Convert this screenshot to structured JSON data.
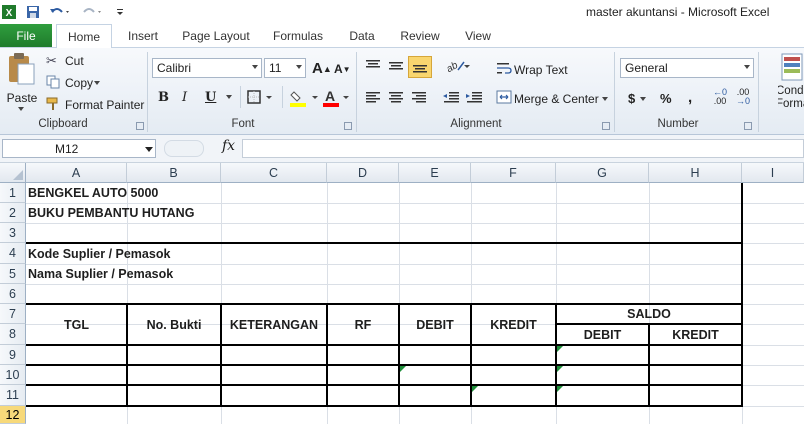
{
  "window": {
    "title": "master akuntansi  -  Microsoft Excel"
  },
  "qat": {
    "undo_icon": "undo-icon",
    "redo_icon": "redo-icon",
    "save_icon": "save-icon",
    "app_icon": "excel-logo"
  },
  "tabs": [
    "File",
    "Home",
    "Insert",
    "Page Layout",
    "Formulas",
    "Data",
    "Review",
    "View"
  ],
  "clipboard": {
    "paste": "Paste",
    "cut": "Cut",
    "copy": "Copy",
    "format_painter": "Format Painter",
    "label": "Clipboard"
  },
  "font": {
    "name": "Calibri",
    "size": "11",
    "label": "Font",
    "bold": "B",
    "italic": "I",
    "underline": "U",
    "grow": "A",
    "shrink": "A",
    "color_letter": "A",
    "fill_color": "#ffff00",
    "font_color": "#ff0000"
  },
  "alignment": {
    "wrap_text": "Wrap Text",
    "merge_center": "Merge & Center",
    "label": "Alignment"
  },
  "number": {
    "format": "General",
    "currency": "$",
    "percent": "%",
    "comma": ",",
    "inc_decimal": ".00",
    "dec_decimal": ".00",
    "label": "Number"
  },
  "styles": {
    "conditional_formatting": "Conditional Formatting"
  },
  "formula_bar": {
    "name_box": "M12",
    "fx": "fx",
    "value": ""
  },
  "columns": [
    "A",
    "B",
    "C",
    "D",
    "E",
    "F",
    "G",
    "H",
    "I"
  ],
  "rows": [
    "1",
    "2",
    "3",
    "4",
    "5",
    "6",
    "7",
    "8",
    "9",
    "10",
    "11",
    "12"
  ],
  "cells": {
    "A1": "BENGKEL AUTO 5000",
    "A2": "BUKU PEMBANTU HUTANG",
    "A4": "Kode Suplier / Pemasok",
    "A5": "Nama Suplier / Pemasok",
    "A7": "TGL",
    "B7": "No. Bukti",
    "C7": "KETERANGAN",
    "D7": "RF",
    "E7": "DEBIT",
    "F7": "KREDIT",
    "G7": "SALDO",
    "G8": "DEBIT",
    "H8": "KREDIT"
  },
  "colors": {
    "file_tab": "#217a2f",
    "selection": "#f7d97a",
    "error_marker": "#1f8f3a"
  }
}
